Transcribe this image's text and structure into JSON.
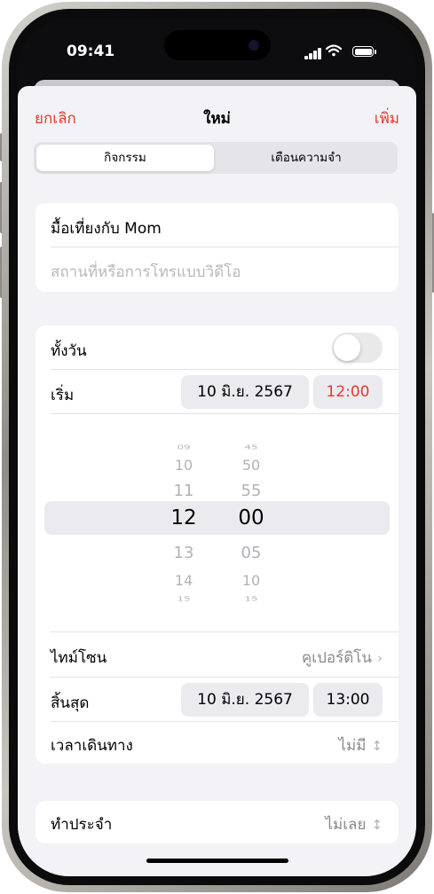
{
  "status_bar": {
    "time": "09:41"
  },
  "nav": {
    "cancel": "ยกเลิก",
    "title": "ใหม่",
    "add": "เพิ่ม"
  },
  "segments": {
    "selected": "กิจกรรม",
    "other": "เตือนความจำ"
  },
  "event": {
    "title_value": "มื้อเที่ยงกับ Mom",
    "location_placeholder": "สถานที่หรือการโทรแบบวิดีโอ"
  },
  "all_day": {
    "label": "ทั้งวัน",
    "on": false
  },
  "start": {
    "label": "เริ่ม",
    "date": "10 มิ.ย. 2567",
    "time": "12:00"
  },
  "time_picker": {
    "hours": [
      "09",
      "10",
      "11",
      "12",
      "13",
      "14",
      "15"
    ],
    "minutes": [
      "45",
      "50",
      "55",
      "00",
      "05",
      "10",
      "15"
    ],
    "selected_hour": "12",
    "selected_minute": "00"
  },
  "timezone": {
    "label": "ไทม์โซน",
    "value": "คูเปอร์ติโน"
  },
  "end": {
    "label": "สิ้นสุด",
    "date": "10 มิ.ย. 2567",
    "time": "13:00"
  },
  "travel_time": {
    "label": "เวลาเดินทาง",
    "value": "ไม่มี"
  },
  "repeat": {
    "label": "ทำประจำ",
    "value": "ไม่เลย"
  },
  "colors": {
    "accent": "#e53a2e",
    "background": "#f2f2f7",
    "chip": "#ebebef"
  },
  "icons": [
    "chevron-right-icon",
    "chevron-updown-icon",
    "signal-icon",
    "wifi-icon",
    "battery-icon"
  ]
}
